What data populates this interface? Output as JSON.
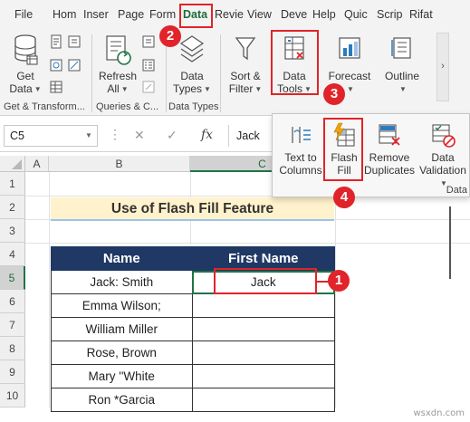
{
  "menu": {
    "tabs": [
      "File",
      "Hom",
      "Inser",
      "Page",
      "Form",
      "Data",
      "Revie",
      "View",
      "Deve",
      "Help",
      "Quic",
      "Scrip",
      "Rifat"
    ],
    "active_tab": "Data"
  },
  "ribbon": {
    "get_data": {
      "line1": "Get",
      "line2": "Data"
    },
    "get_transform_label": "Get & Transform...",
    "refresh_all": {
      "line1": "Refresh",
      "line2": "All"
    },
    "queries_label": "Queries & C...",
    "data_types": {
      "line1": "Data",
      "line2": "Types"
    },
    "data_types_label": "Data Types",
    "sort_filter": {
      "line1": "Sort &",
      "line2": "Filter"
    },
    "data_tools": {
      "line1": "Data",
      "line2": "Tools"
    },
    "forecast": {
      "line1": "Forecast"
    },
    "outline": {
      "line1": "Outline"
    }
  },
  "formula_bar": {
    "name_box": "C5",
    "cancel": "✕",
    "enter": "✓",
    "fx": "fx",
    "value": "Jack"
  },
  "sheet": {
    "columns": [
      "A",
      "B",
      "C"
    ],
    "rows": [
      "1",
      "2",
      "3",
      "4",
      "5",
      "6",
      "7",
      "8",
      "9",
      "10"
    ],
    "title": "Use of Flash Fill Feature",
    "table": {
      "headers": [
        "Name",
        "First Name"
      ],
      "rows": [
        [
          "Jack: Smith",
          "Jack"
        ],
        [
          "Emma Wilson;",
          ""
        ],
        [
          "William Miller",
          ""
        ],
        [
          "Rose, Brown",
          ""
        ],
        [
          "Mary ''White",
          ""
        ],
        [
          "Ron *Garcia",
          ""
        ]
      ]
    }
  },
  "dropdown": {
    "text_to_columns": {
      "line1": "Text to",
      "line2": "Columns"
    },
    "flash_fill": {
      "line1": "Flash",
      "line2": "Fill"
    },
    "remove_duplicates": {
      "line1": "Remove",
      "line2": "Duplicates"
    },
    "data_validation": {
      "line1": "Data",
      "line2": "Validation"
    },
    "group_label": "Data"
  },
  "annotations": {
    "step1": "1",
    "step2": "2",
    "step3": "3",
    "step4": "4"
  },
  "colors": {
    "accent_red": "#e0242a",
    "header_navy": "#1f3864",
    "title_fill": "#fff2cc",
    "excel_green": "#217346"
  },
  "watermark": "wsxdn.com"
}
